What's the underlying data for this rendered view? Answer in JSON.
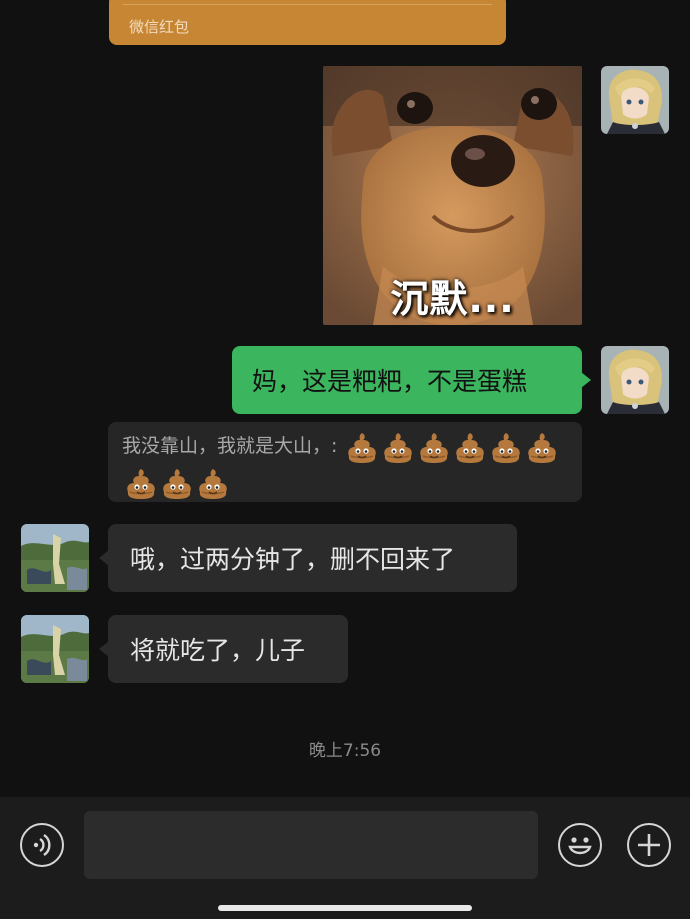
{
  "red_packet": {
    "label": "微信红包"
  },
  "sticker": {
    "caption": "沉默..."
  },
  "messages": {
    "sent_text": "妈，这是粑粑，不是蛋糕",
    "quote_text": "我没靠山，我就是大山，:",
    "reply_1": "哦，过两分钟了，删不回来了",
    "reply_2": "将就吃了，儿子"
  },
  "timestamp": "晚上7:56",
  "input_bar": {
    "value": ""
  },
  "icons": [
    "voice-icon",
    "emoji-icon",
    "plus-icon",
    "poop-emoji"
  ]
}
